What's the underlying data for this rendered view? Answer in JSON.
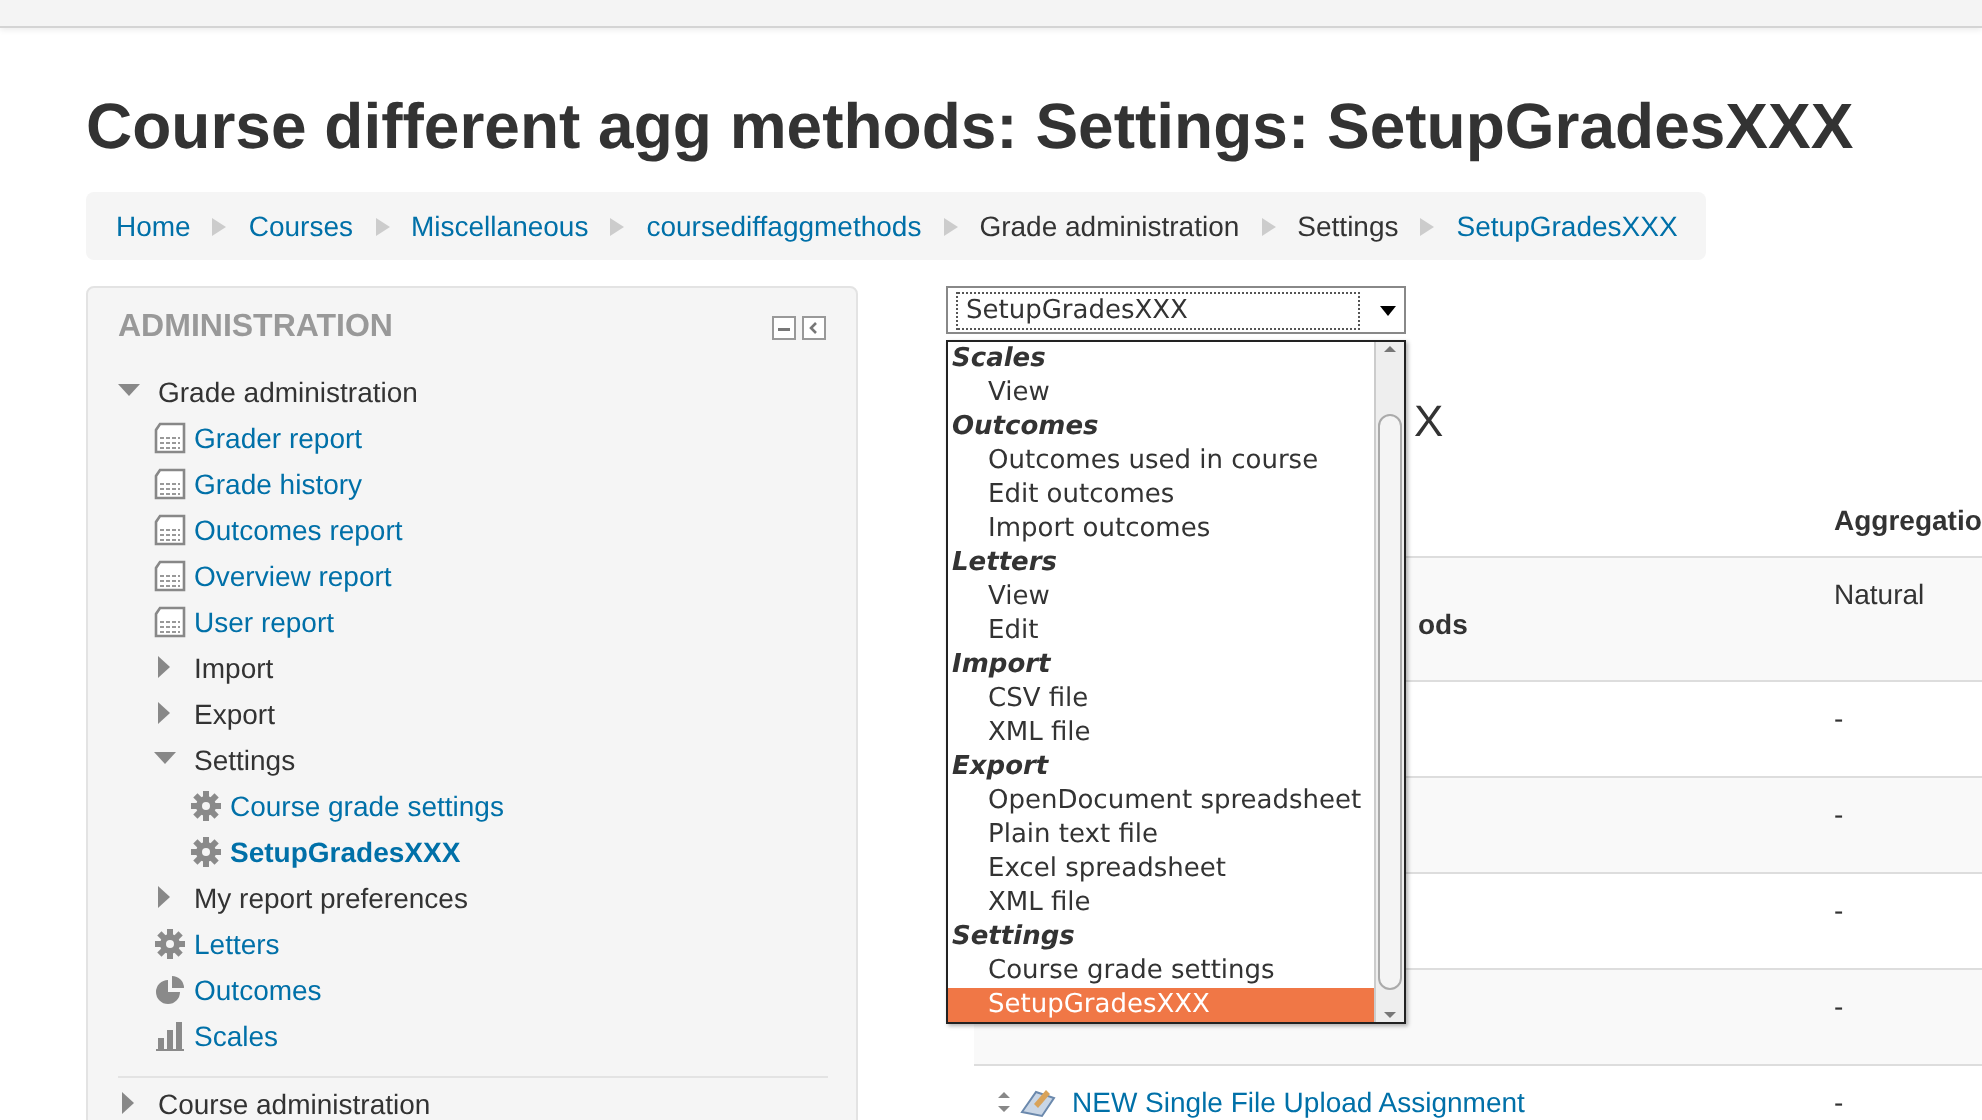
{
  "page_title": "Course different agg methods: Settings: SetupGradesXXX",
  "breadcrumb": [
    {
      "label": "Home",
      "link": true
    },
    {
      "label": "Courses",
      "link": true
    },
    {
      "label": "Miscellaneous",
      "link": true
    },
    {
      "label": "coursediffaggmethods",
      "link": true
    },
    {
      "label": "Grade administration",
      "link": false
    },
    {
      "label": "Settings",
      "link": false
    },
    {
      "label": "SetupGradesXXX",
      "link": true
    }
  ],
  "sidebar": {
    "title": "ADMINISTRATION",
    "tree": [
      {
        "label": "Grade administration",
        "kind": "branch",
        "expanded": true,
        "selected": false,
        "children": [
          {
            "label": "Grader report",
            "kind": "report",
            "selected": false
          },
          {
            "label": "Grade history",
            "kind": "report",
            "selected": false
          },
          {
            "label": "Outcomes report",
            "kind": "report",
            "selected": false
          },
          {
            "label": "Overview report",
            "kind": "report",
            "selected": false
          },
          {
            "label": "User report",
            "kind": "report",
            "selected": false
          },
          {
            "label": "Import",
            "kind": "branch",
            "expanded": false,
            "selected": false
          },
          {
            "label": "Export",
            "kind": "branch",
            "expanded": false,
            "selected": false
          },
          {
            "label": "Settings",
            "kind": "branch",
            "expanded": true,
            "selected": false,
            "children": [
              {
                "label": "Course grade settings",
                "kind": "gear",
                "selected": false
              },
              {
                "label": "SetupGradesXXX",
                "kind": "gear",
                "selected": true
              }
            ]
          },
          {
            "label": "My report preferences",
            "kind": "branch",
            "expanded": false,
            "selected": false
          },
          {
            "label": "Letters",
            "kind": "gear",
            "selected": false
          },
          {
            "label": "Outcomes",
            "kind": "outcomes",
            "selected": false
          },
          {
            "label": "Scales",
            "kind": "scales",
            "selected": false
          }
        ]
      },
      {
        "label": "Course administration",
        "kind": "branch",
        "expanded": false,
        "selected": false,
        "divider": true
      }
    ]
  },
  "jump_select": {
    "value": "SetupGradesXXX",
    "groups": [
      {
        "label": "Scales",
        "options": [
          {
            "label": "View",
            "selected": false
          }
        ]
      },
      {
        "label": "Outcomes",
        "options": [
          {
            "label": "Outcomes used in course",
            "selected": false
          },
          {
            "label": "Edit outcomes",
            "selected": false
          },
          {
            "label": "Import outcomes",
            "selected": false
          }
        ]
      },
      {
        "label": "Letters",
        "options": [
          {
            "label": "View",
            "selected": false
          },
          {
            "label": "Edit",
            "selected": false
          }
        ]
      },
      {
        "label": "Import",
        "options": [
          {
            "label": "CSV file",
            "selected": false
          },
          {
            "label": "XML file",
            "selected": false
          }
        ]
      },
      {
        "label": "Export",
        "options": [
          {
            "label": "OpenDocument spreadsheet",
            "selected": false
          },
          {
            "label": "Plain text file",
            "selected": false
          },
          {
            "label": "Excel spreadsheet",
            "selected": false
          },
          {
            "label": "XML file",
            "selected": false
          }
        ]
      },
      {
        "label": "Settings",
        "options": [
          {
            "label": "Course grade settings",
            "selected": false
          },
          {
            "label": "SetupGradesXXX",
            "selected": true
          }
        ]
      }
    ]
  },
  "section_heading_fragment": "X",
  "table": {
    "columns": [
      {
        "label": "Aggregatio"
      }
    ],
    "rows": [
      {
        "kind": "category",
        "name": "ods",
        "value": "Natural"
      },
      {
        "kind": "blank",
        "value": "-"
      },
      {
        "kind": "blank",
        "value": "-"
      },
      {
        "kind": "blank",
        "value": "-"
      },
      {
        "kind": "blank",
        "value": "-"
      },
      {
        "kind": "item",
        "name": "NEW Single File Upload Assignment",
        "value": "-"
      }
    ]
  }
}
